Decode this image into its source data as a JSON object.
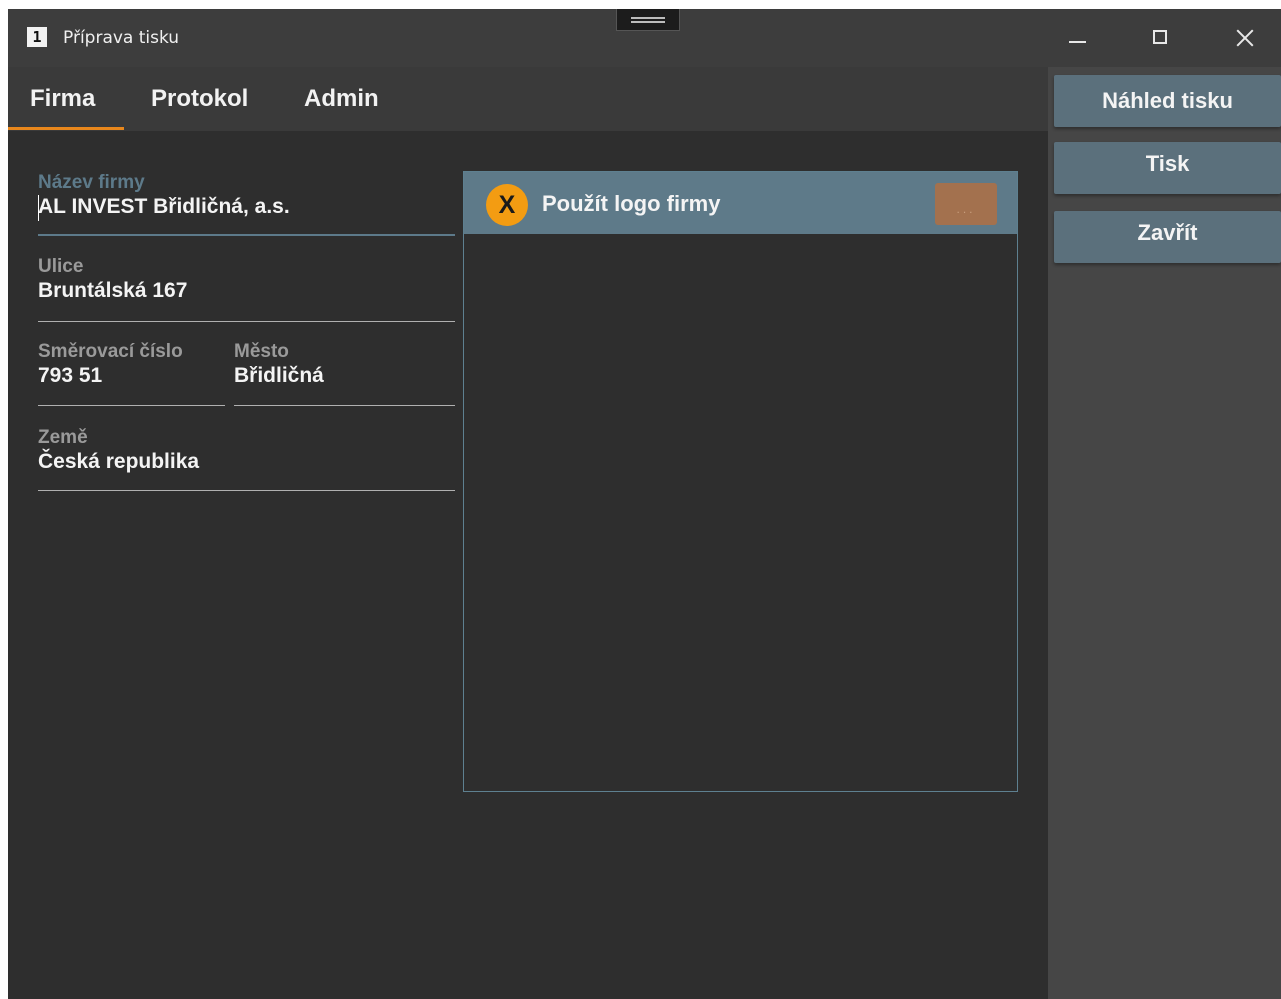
{
  "window": {
    "title": "Příprava tisku"
  },
  "tabs": [
    {
      "label": "Firma",
      "selected": true
    },
    {
      "label": "Protokol",
      "selected": false
    },
    {
      "label": "Admin",
      "selected": false
    }
  ],
  "form": {
    "company_name": {
      "label": "Název firmy",
      "value": "AL INVEST Břidličná, a.s."
    },
    "street": {
      "label": "Ulice",
      "value": "Bruntálská 167"
    },
    "postal_code": {
      "label": "Směrovací číslo",
      "value": "793 51"
    },
    "city": {
      "label": "Město",
      "value": "Břidličná"
    },
    "country": {
      "label": "Země",
      "value": "Česká republika"
    }
  },
  "logo": {
    "badge": "X",
    "title": "Použít logo firmy",
    "browse_label": "..."
  },
  "actions": {
    "preview": "Náhled tisku",
    "print": "Tisk",
    "close": "Zavřít"
  },
  "colors": {
    "accent": "#e8871c",
    "button": "#5b707c",
    "badge": "#f39c12",
    "browse": "#a3714e"
  }
}
